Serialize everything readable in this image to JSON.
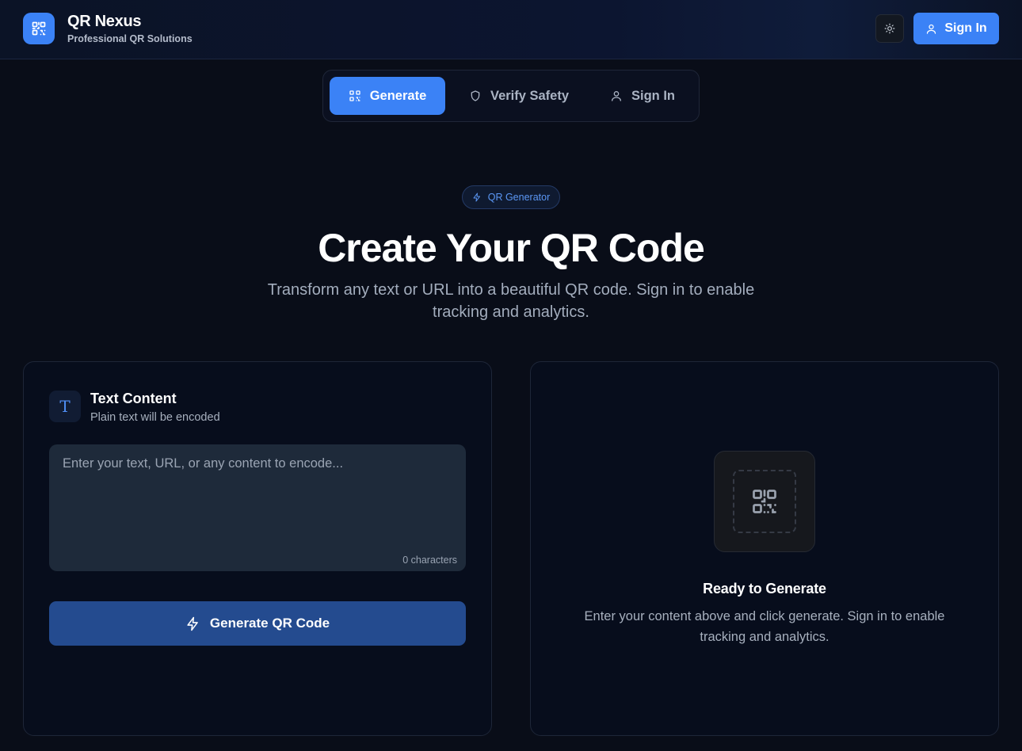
{
  "header": {
    "brand_title": "QR Nexus",
    "brand_subtitle": "Professional QR Solutions",
    "logo_icon": "qr-code-icon",
    "theme_icon": "sun-icon",
    "sign_in_label": "Sign In",
    "sign_in_icon": "user-icon"
  },
  "tabs": [
    {
      "label": "Generate",
      "icon": "qr-code-icon",
      "active": true
    },
    {
      "label": "Verify Safety",
      "icon": "shield-icon",
      "active": false
    },
    {
      "label": "Sign In",
      "icon": "user-icon",
      "active": false
    }
  ],
  "hero": {
    "badge": "QR Generator",
    "badge_icon": "lightning-icon",
    "title": "Create Your QR Code",
    "subtitle": "Transform any text or URL into a beautiful QR code. Sign in to enable tracking and analytics."
  },
  "input_card": {
    "icon_glyph": "T",
    "title": "Text Content",
    "subtitle": "Plain text will be encoded",
    "placeholder": "Enter your text, URL, or any content to encode...",
    "value": "",
    "char_count": "0 characters",
    "generate_label": "Generate QR Code",
    "generate_icon": "lightning-icon"
  },
  "preview_card": {
    "icon": "qr-code-icon",
    "title": "Ready to Generate",
    "subtitle": "Enter your content above and click generate. Sign in to enable tracking and analytics."
  },
  "colors": {
    "accent": "#3b82f6",
    "background": "#090d18",
    "card": "#070d1c",
    "generate_button": "#244b8f"
  }
}
